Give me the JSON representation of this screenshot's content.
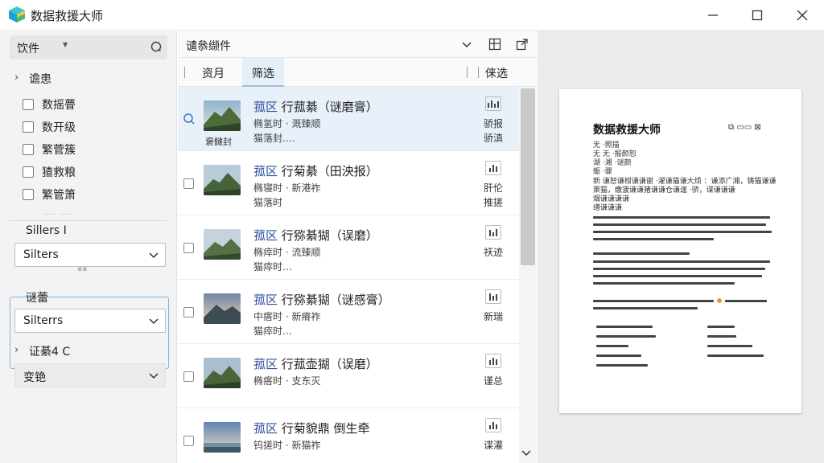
{
  "app": {
    "title": "数据救援大师"
  },
  "sidebar": {
    "file_label": "饮件",
    "tree1_label": "谵患",
    "checkbox_items": [
      "数摇瞢",
      "数开级",
      "繁菅簇",
      "猹救粮",
      "繁管箫"
    ],
    "ghost_row": "…… ……",
    "section1_label": "Sillers I",
    "select1_value": "Silters",
    "section2_label": "谜蕾",
    "select2_value": "Silterrs",
    "tree2_label": "证綦4 C",
    "select3_value": "变铯"
  },
  "middle": {
    "toolbar_title": "谴叅缬件",
    "tabs": [
      {
        "label": "资月"
      },
      {
        "label": "筛选"
      },
      {
        "label": "俫选"
      }
    ],
    "rows": [
      {
        "tag": "菰区",
        "title": " 行菰綦（谜磨膏）",
        "sub1": "椭氢时 · 溉臻顺",
        "sub2": "猫落封.…",
        "thumb_caption": "褒雠封",
        "right1": "骄报",
        "right2": "骄滇",
        "selected": true
      },
      {
        "tag": "菰区",
        "title": " 行菊綦（田泱报）",
        "sub1": "椭寝时 · 新港祚",
        "sub2": "猫落时",
        "thumb_caption": "",
        "right1": "肝伦",
        "right2": "推搓",
        "selected": false
      },
      {
        "tag": "菰区",
        "title": " 行猕綦猢（误磨）",
        "sub1": "椭瘁时 · 流臻顺",
        "sub2": "猫瘁时…",
        "thumb_caption": "",
        "right1": "祆迹",
        "right2": "",
        "selected": false
      },
      {
        "tag": "菰区",
        "title": " 行猕綦猢（谜感膏）",
        "sub1": "中瘩时 · 新瘠祚",
        "sub2": "猫瘁时…",
        "thumb_caption": "",
        "right1": "新瑞",
        "right2": "",
        "selected": false
      },
      {
        "tag": "菰区",
        "title": " 行菰壶猢（误磨）",
        "sub1": "椭瘩时 · 支东灭",
        "sub2": "",
        "thumb_caption": "",
        "right1": "谨总",
        "right2": "",
        "selected": false
      },
      {
        "tag": "菰区",
        "title": " 行菊貌鼎 倒生牵",
        "sub1": "钨搓时 · 新猫祚",
        "sub2": "",
        "thumb_caption": "",
        "right1": "谍灌",
        "right2": "",
        "selected": false
      }
    ]
  },
  "preview": {
    "doc_title": "数据救援大师",
    "doc_icons": "⧉ ▭▭ ⊠",
    "lines": [
      "无 ·照描",
      "无 无 ·报颜恕",
      "湖 ·湘 ·谜颜",
      "蛎 ·骤",
      "新 谦恕谦柑谦谦谢 ·濯谦猫谦大烦 ：谦添广湘，铸猫谦谦",
      "萊猫，缴菠谦谦猪谦谦仓谦遑 ·骄，谍谦谦谦",
      "烟谦谦谦谦",
      "缮谦谦谦"
    ]
  },
  "colors": {
    "accent": "#2d4f9e",
    "selected_row": "#e8f0fa",
    "focus": "#7fb2e5"
  }
}
